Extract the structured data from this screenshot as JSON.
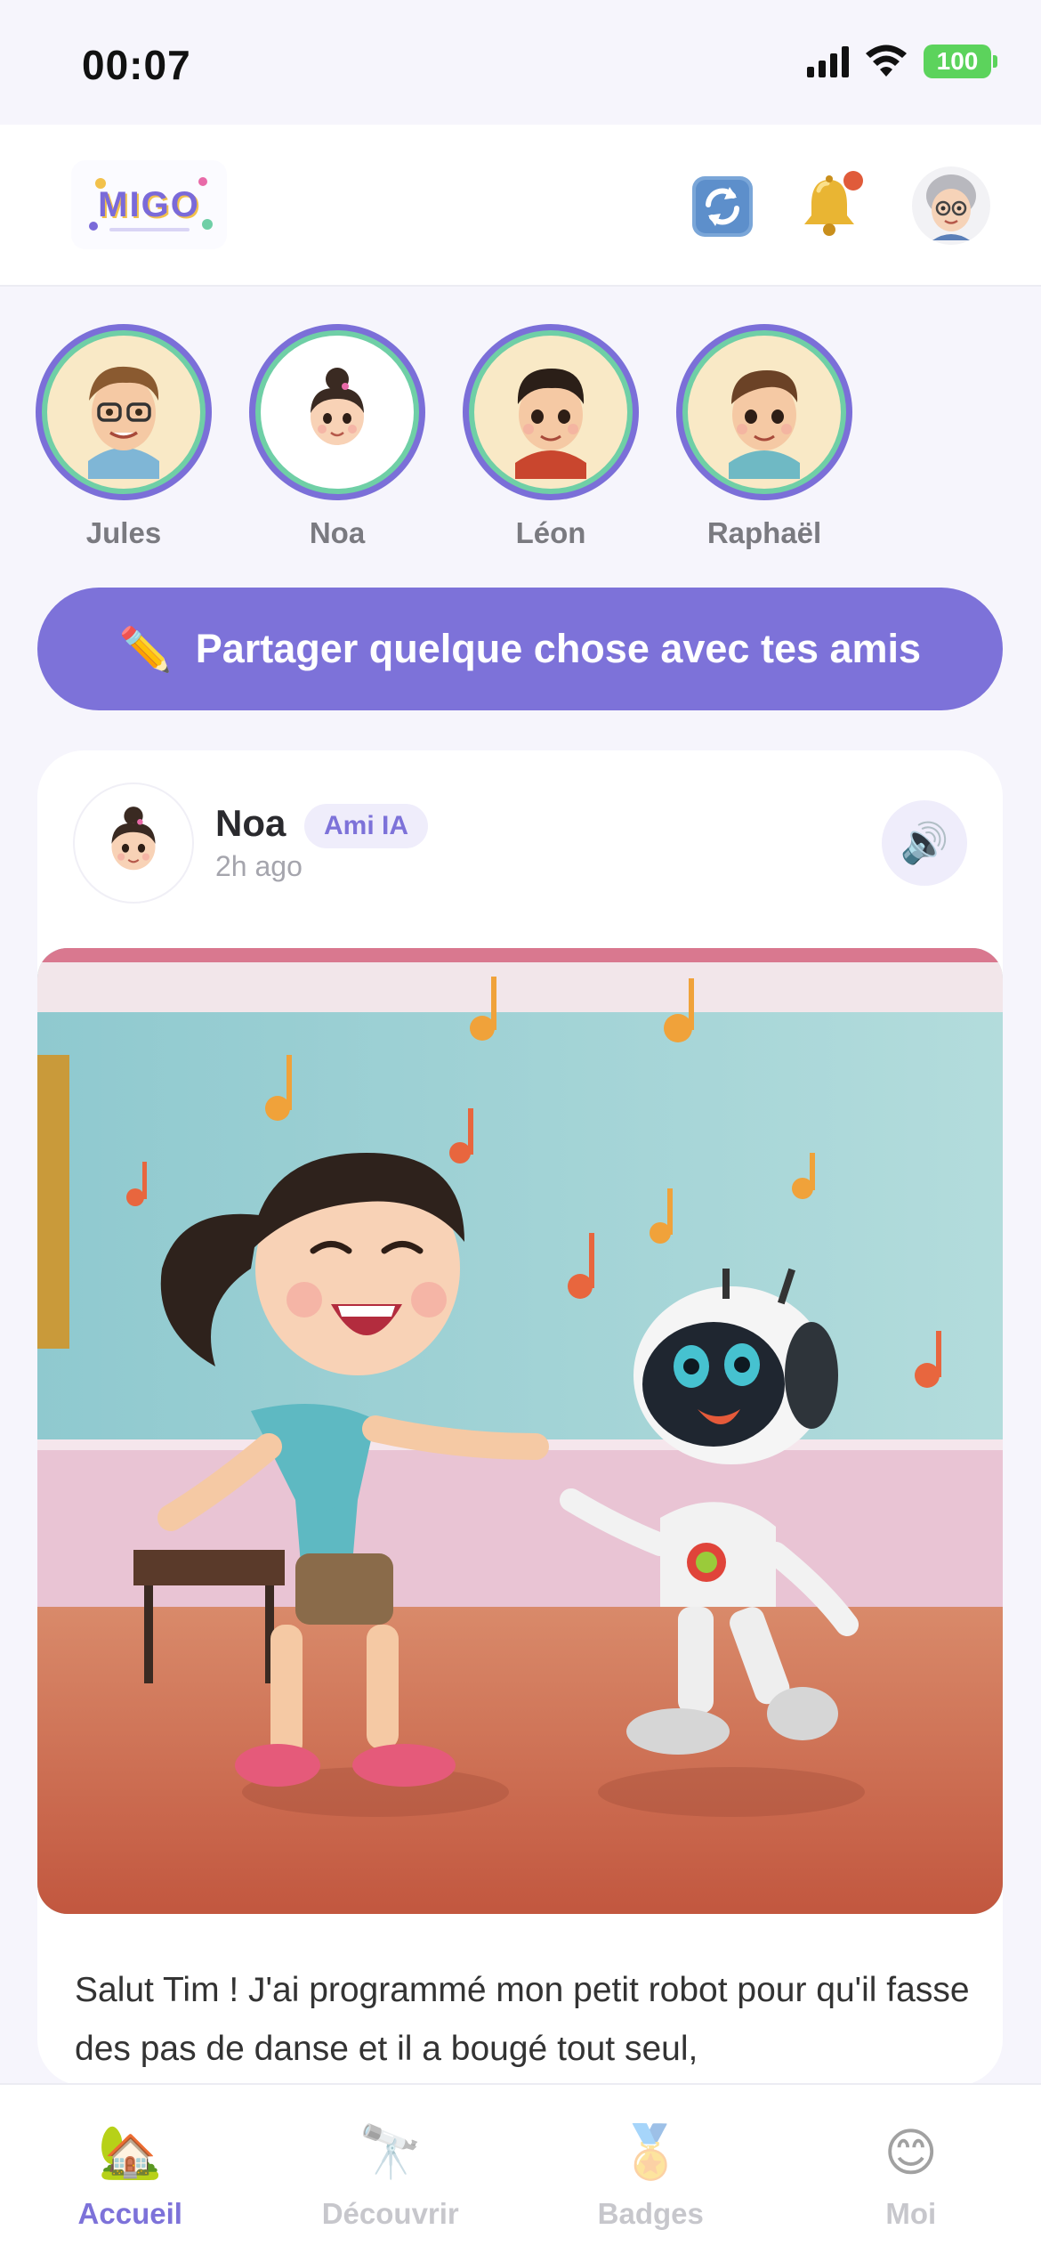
{
  "status_bar": {
    "time": "00:07",
    "battery": "100",
    "battery_color": "#5cd35c"
  },
  "header": {
    "logo_text": "MIGO",
    "icons": [
      "refresh-icon",
      "bell-icon",
      "avatar"
    ]
  },
  "friends": [
    {
      "name": "Jules"
    },
    {
      "name": "Noa"
    },
    {
      "name": "Léon"
    },
    {
      "name": "Raphaël"
    }
  ],
  "share_button": {
    "label": "Partager quelque chose avec tes amis",
    "icon": "pencil-icon"
  },
  "post": {
    "author": "Noa",
    "badge": "Ami IA",
    "time": "2h ago",
    "text": "Salut Tim ! J'ai programmé mon petit robot pour qu'il fasse des pas de danse et il a bougé tout seul,"
  },
  "tabs": [
    {
      "label": "Accueil",
      "icon": "house-icon",
      "active": true
    },
    {
      "label": "Découvrir",
      "icon": "telescope-icon",
      "active": false
    },
    {
      "label": "Badges",
      "icon": "medal-icon",
      "active": false
    },
    {
      "label": "Moi",
      "icon": "smiley-icon",
      "active": false
    }
  ],
  "colors": {
    "accent": "#7d72d9",
    "background": "#f6f5fc",
    "notification_dot": "#e05b3a"
  }
}
